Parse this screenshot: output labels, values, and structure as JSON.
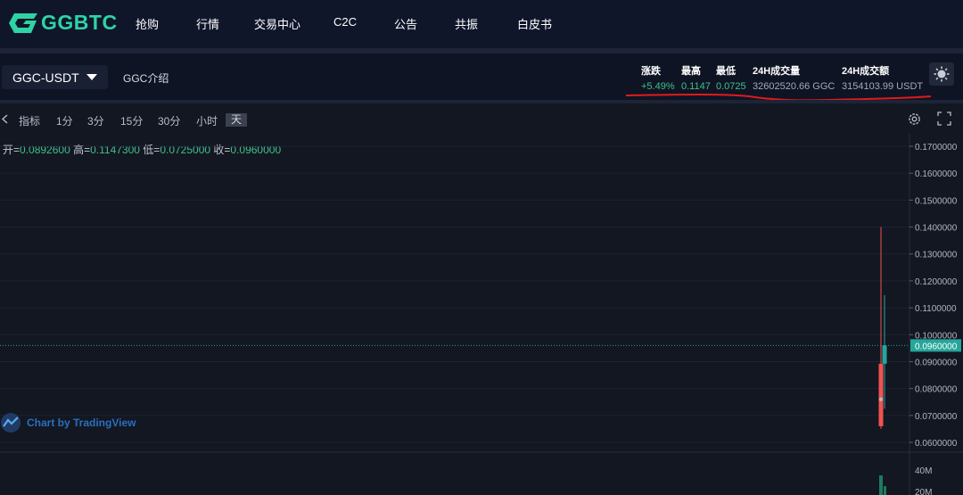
{
  "brand": {
    "name": "GGBTC",
    "color": "#2ed3a6"
  },
  "nav": {
    "items": [
      {
        "label": "抢购"
      },
      {
        "label": "行情"
      },
      {
        "label": "交易中心"
      },
      {
        "label": "C2C"
      },
      {
        "label": "公告"
      },
      {
        "label": "共振"
      },
      {
        "label": "白皮书"
      }
    ]
  },
  "market": {
    "pair": "GGC-USDT",
    "intro_link": "GGC介绍",
    "stats": {
      "change_label": "涨跌",
      "change_value": "+5.49%",
      "high_label": "最高",
      "high_value": "0.1147",
      "low_label": "最低",
      "low_value": "0.0725",
      "vol_label": "24H成交量",
      "vol_value": "32602520.66 GGC",
      "amount_label": "24H成交额",
      "amount_value": "3154103.99 USDT"
    },
    "theme_icon": "sun-icon"
  },
  "toolbar": {
    "indicators": "指标",
    "intervals": [
      "1分",
      "3分",
      "15分",
      "30分",
      "小时",
      "天"
    ],
    "active_interval": "天",
    "icons": [
      "settings-icon",
      "fullscreen-icon"
    ]
  },
  "ohlc": {
    "open_label": "开=",
    "open": "0.0892600",
    "high_label": "高=",
    "high": "0.1147300",
    "low_label": "低=",
    "low": "0.0725000",
    "close_label": "收=",
    "close": "0.0960000"
  },
  "tradingview": {
    "label": "Chart by TradingView"
  },
  "colors": {
    "up": "#26a69a",
    "down": "#ef5350",
    "green_text": "#3fc08a",
    "annotation": "#e01b1b"
  },
  "chart_data": {
    "type": "candlestick",
    "price_axis": {
      "ticks": [
        "0.1700000",
        "0.1600000",
        "0.1500000",
        "0.1400000",
        "0.1300000",
        "0.1200000",
        "0.1100000",
        "0.1000000",
        "0.0900000",
        "0.0800000",
        "0.0700000",
        "0.0600000"
      ],
      "range": [
        0.06,
        0.17
      ],
      "last_price_label": "0.0960000",
      "last_price": 0.096
    },
    "candles": [
      {
        "open": 0.0892,
        "high": 0.14,
        "low": 0.065,
        "close": 0.066
      },
      {
        "open": 0.076,
        "high": 0.076,
        "low": 0.076,
        "close": 0.076
      },
      {
        "open": 0.0892,
        "high": 0.1147,
        "low": 0.0725,
        "close": 0.096
      }
    ],
    "volume_axis": {
      "ticks": [
        "40M",
        "20M"
      ]
    },
    "volumes": [
      0,
      0,
      20
    ]
  }
}
